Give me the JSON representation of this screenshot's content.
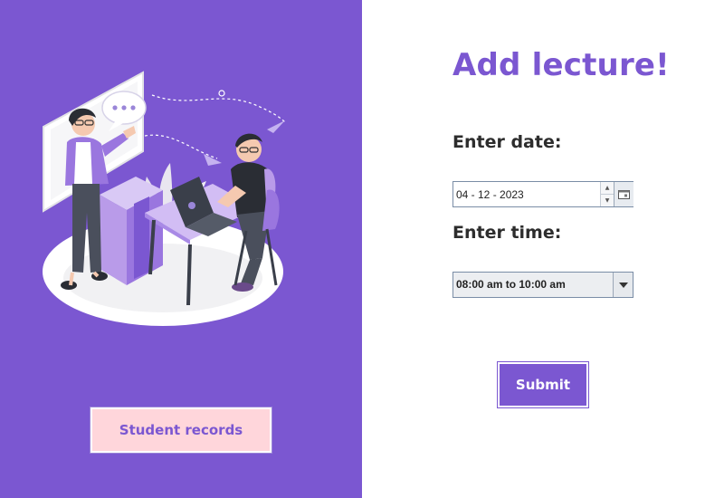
{
  "left": {
    "records_button": "Student records"
  },
  "form": {
    "title": "Add lecture!",
    "date_label": "Enter date:",
    "date_value": "04 - 12 - 2023",
    "time_label": "Enter time:",
    "time_value": "08:00 am to 10:00 am",
    "submit_label": "Submit"
  },
  "icons": {
    "calendar": "calendar-icon",
    "dropdown": "chevron-down-icon",
    "spin_up": "spin-up-icon",
    "spin_down": "spin-down-icon"
  },
  "colors": {
    "accent": "#7b57d1",
    "records_button_bg": "#ffd6db",
    "label_text": "#2d2d2d"
  }
}
